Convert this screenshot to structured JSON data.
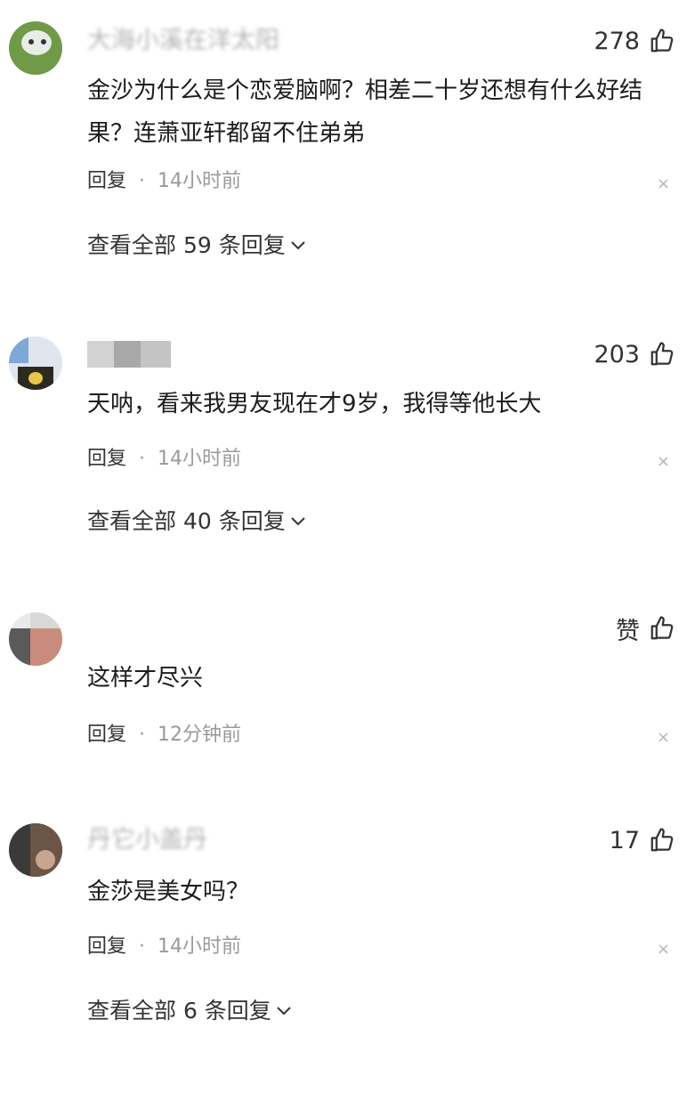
{
  "comments": [
    {
      "username": "大海小溪在洋太阳",
      "likes": "278",
      "text": "金沙为什么是个恋爱脑啊？相差二十岁还想有什么好结果？连萧亚轩都留不住弟弟",
      "reply": "回复",
      "separator": "·",
      "time": "14小时前",
      "view_replies": "查看全部 59 条回复",
      "close": "×",
      "avatar_icon": "avatar-icon"
    },
    {
      "username": "",
      "likes": "203",
      "text": "天呐，看来我男友现在才9岁，我得等他长大",
      "reply": "回复",
      "separator": "·",
      "time": "14小时前",
      "view_replies": "查看全部 40 条回复",
      "close": "×",
      "avatar_icon": "avatar-icon"
    },
    {
      "username": "",
      "likes": "赞",
      "text": "这样才尽兴",
      "reply": "回复",
      "separator": "·",
      "time": "12分钟前",
      "close": "×",
      "avatar_icon": "avatar-icon"
    },
    {
      "username": "丹它小盖丹",
      "likes": "17",
      "text": "金莎是美女吗？",
      "reply": "回复",
      "separator": "·",
      "time": "14小时前",
      "view_replies": "查看全部 6 条回复",
      "close": "×",
      "avatar_icon": "avatar-icon"
    }
  ],
  "icons": {
    "like": "thumbs-up-icon",
    "chevron": "chevron-down-icon",
    "close": "close-icon"
  },
  "colors": {
    "text": "#1c1c1c",
    "muted": "#9a9a9a",
    "background": "#ffffff"
  }
}
